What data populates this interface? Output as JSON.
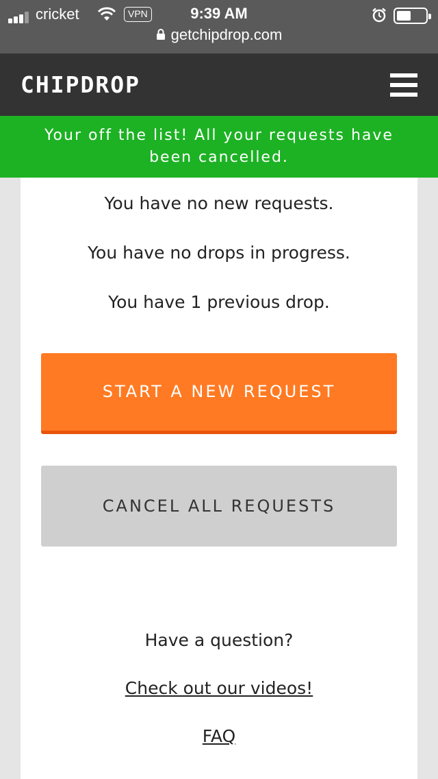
{
  "status_bar": {
    "carrier": "cricket",
    "vpn": "VPN",
    "time": "9:39 AM",
    "url": "getchipdrop.com"
  },
  "header": {
    "logo": "CHIPDROP"
  },
  "banner": {
    "line1": "Your off the list! All your requests have",
    "line2": "been cancelled."
  },
  "summary": {
    "new_requests": "You have no new requests.",
    "drops_in_progress": "You have no drops in progress.",
    "previous_drops": "You have 1 previous drop."
  },
  "actions": {
    "start_label": "START A NEW REQUEST",
    "cancel_label": "CANCEL ALL REQUESTS"
  },
  "help": {
    "question": "Have a question?",
    "videos_link": "Check out our videos!",
    "faq_link": "FAQ"
  },
  "colors": {
    "banner": "#1db224",
    "primary_button": "#ff7a22",
    "secondary_button": "#cfcfcf",
    "header": "#333333"
  }
}
